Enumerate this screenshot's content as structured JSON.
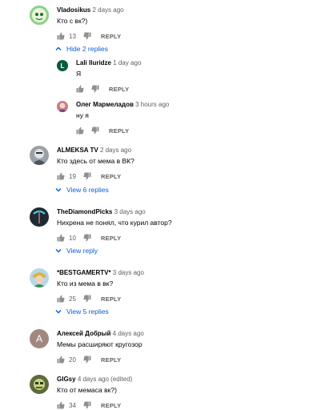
{
  "icons": {
    "like": "thumb-up-icon",
    "dislike": "thumb-down-icon",
    "expand": "chevron-down-icon",
    "collapse": "chevron-up-icon"
  },
  "colors": {
    "link": "#065fd4",
    "secondary_text": "#606060",
    "avatar_letter_bg": "#a1887f",
    "avatar_l_bg": "#0b5a3e"
  },
  "reply_label": "REPLY",
  "comments": [
    {
      "author": "Vladosikus",
      "time": "2 days ago",
      "text": "Кто с вк?)",
      "likes": "13",
      "replies_toggle": "Hide 2 replies",
      "replies": [
        {
          "author": "Lali Iluridze",
          "time": "1 day ago",
          "text": "Я",
          "avatar_letter": "L"
        },
        {
          "author": "Олег Мармеладов",
          "time": "3 hours ago",
          "text": "ну я"
        }
      ]
    },
    {
      "author": "ALMEKSA TV",
      "time": "2 days ago",
      "text": "Кто здесь от мема в ВК?",
      "likes": "19",
      "replies_toggle": "View 6 replies"
    },
    {
      "author": "TheDiamondPicks",
      "time": "3 days ago",
      "text": "Нихрена не понял, что курил автор?",
      "likes": "10",
      "replies_toggle": "View reply"
    },
    {
      "author": "*BESTGAMERTV*",
      "time": "3 days ago",
      "text": "Кто из мема в вк?",
      "likes": "25",
      "replies_toggle": "View 5 replies"
    },
    {
      "author": "Алексей Добрый",
      "time": "4 days ago",
      "text": "Мемы расширяют кругозор",
      "likes": "20",
      "avatar_letter": "А"
    },
    {
      "author": "GIGsy",
      "time": "4 days ago (edited)",
      "text": "Кто от мемаса вк?)",
      "likes": "34"
    }
  ]
}
